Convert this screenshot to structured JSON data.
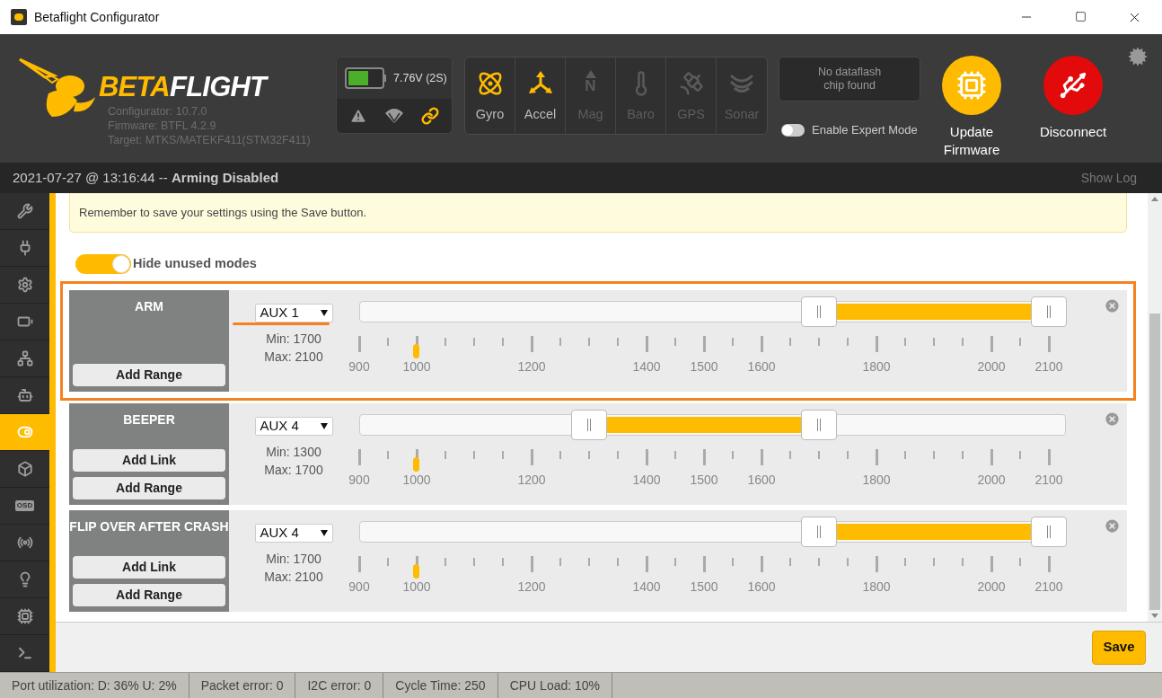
{
  "window": {
    "title": "Betaflight Configurator"
  },
  "header": {
    "logo": {
      "part_1": "BETA",
      "part_2": "FLIGHT"
    },
    "info": [
      "Configurator: 10.7.0",
      "Firmware: BTFL 4.2.9",
      "Target: MTKS/MATEKF411(STM32F411)"
    ],
    "battery": {
      "reading": "7.76V (2S)"
    },
    "indicators": [
      {
        "kind": "warning",
        "active": false
      },
      {
        "kind": "parachute",
        "active": false
      },
      {
        "kind": "link",
        "active": true
      }
    ],
    "sensors": [
      {
        "kind": "gyro",
        "label": "Gyro",
        "active": true
      },
      {
        "kind": "accel",
        "label": "Accel",
        "active": true
      },
      {
        "kind": "mag",
        "label": "Mag",
        "active": false,
        "icon_text": "N"
      },
      {
        "kind": "baro",
        "label": "Baro",
        "active": false
      },
      {
        "kind": "gps",
        "label": "GPS",
        "active": false
      },
      {
        "kind": "sonar",
        "label": "Sonar",
        "active": false
      }
    ],
    "dataflash": [
      "No dataflash",
      "chip found"
    ],
    "expert_mode": {
      "label": "Enable Expert Mode",
      "on": false
    },
    "buttons": [
      {
        "kind": "update",
        "label": "Update Firmware"
      },
      {
        "kind": "disconnect",
        "label": "Disconnect"
      }
    ]
  },
  "status_line": {
    "text": "2021-07-27 @ 13:16:44 -- **Arming Disabled**",
    "link": "Show Log"
  },
  "sidebar": {
    "items": [
      {
        "kind": "wrench",
        "selected": false
      },
      {
        "kind": "plug",
        "selected": false
      },
      {
        "kind": "gear",
        "selected": false
      },
      {
        "kind": "battery",
        "selected": false
      },
      {
        "kind": "network",
        "selected": false
      },
      {
        "kind": "robot",
        "selected": false
      },
      {
        "kind": "toggles",
        "selected": true
      },
      {
        "kind": "motor",
        "selected": false
      },
      {
        "kind": "osd",
        "selected": false,
        "icon_text": "OSD"
      },
      {
        "kind": "radio",
        "selected": false
      },
      {
        "kind": "led",
        "selected": false
      },
      {
        "kind": "chip",
        "selected": false
      },
      {
        "kind": "terminal",
        "selected": false
      }
    ]
  },
  "notice": "Remember to save your settings using the Save button.",
  "hide_unused": {
    "label": "Hide unused modes",
    "on": true
  },
  "modes": [
    {
      "name": "ARM",
      "highlighted": true,
      "buttons": [
        "Add Range"
      ],
      "channel": "AUX 1",
      "min": "Min: 1700",
      "max": "Max: 2100",
      "range": {
        "low": {
          "level": 0.6667
        },
        "high": {
          "level": 1
        }
      },
      "current": {
        "level": 0.0833
      },
      "scale": [
        "900",
        "1000",
        "1200",
        "1400",
        "1500",
        "1600",
        "1800",
        "2000",
        "2100"
      ]
    },
    {
      "name": "BEEPER",
      "highlighted": false,
      "buttons": [
        "Add Link",
        "Add Range"
      ],
      "channel": "AUX 4",
      "min": "Min: 1300",
      "max": "Max: 1700",
      "range": {
        "low": {
          "level": 0.3333
        },
        "high": {
          "level": 0.6667
        }
      },
      "current": {
        "level": 0.0833
      },
      "scale": [
        "900",
        "1000",
        "1200",
        "1400",
        "1500",
        "1600",
        "1800",
        "2000",
        "2100"
      ]
    },
    {
      "name": "FLIP OVER AFTER CRASH",
      "highlighted": false,
      "buttons": [
        "Add Link",
        "Add Range"
      ],
      "channel": "AUX 4",
      "min": "Min: 1700",
      "max": "Max: 2100",
      "range": {
        "low": {
          "level": 0.6667
        },
        "high": {
          "level": 1
        }
      },
      "current": {
        "level": 0.0833
      },
      "scale": [
        "900",
        "1000",
        "1200",
        "1400",
        "1500",
        "1600",
        "1800",
        "2000",
        "2100"
      ]
    }
  ],
  "save": "Save",
  "status_bar": [
    "Port utilization: D: 36% U: 2%",
    "Packet error: 0",
    "I2C error: 0",
    "Cycle Time: 250",
    "CPU Load: 10%"
  ]
}
